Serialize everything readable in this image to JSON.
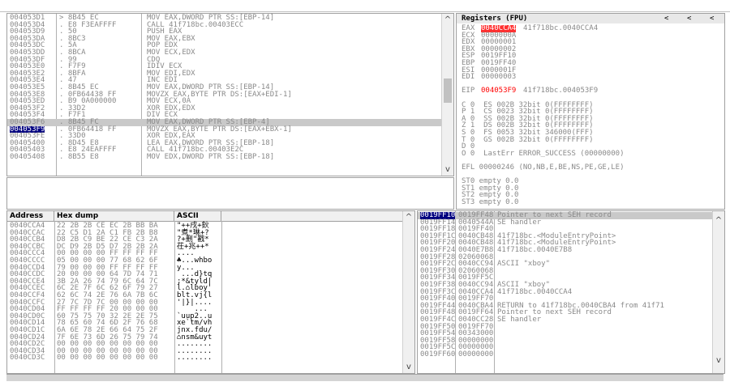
{
  "disasm": {
    "rows": [
      {
        "addr": "004053D1",
        "hex": "> 8B45 EC",
        "ins": "MOV EAX,DWORD PTR SS:[EBP-14]"
      },
      {
        "addr": "004053D4",
        "hex": ". E8 F3EAFFFF",
        "ins": "CALL 41f718bc.00403ECC"
      },
      {
        "addr": "004053D9",
        "hex": ". 50",
        "ins": "PUSH EAX"
      },
      {
        "addr": "004053DA",
        "hex": ". 8BC3",
        "ins": "MOV EAX,EBX"
      },
      {
        "addr": "004053DC",
        "hex": ". 5A",
        "ins": "POP EDX"
      },
      {
        "addr": "004053DD",
        "hex": ". 8BCA",
        "ins": "MOV ECX,EDX"
      },
      {
        "addr": "004053DF",
        "hex": ". 99",
        "ins": "CDQ"
      },
      {
        "addr": "004053E0",
        "hex": ". F7F9",
        "ins": "IDIV ECX"
      },
      {
        "addr": "004053E2",
        "hex": ". 8BFA",
        "ins": "MOV EDI,EDX"
      },
      {
        "addr": "004053E4",
        "hex": ". 47",
        "ins": "INC EDI"
      },
      {
        "addr": "004053E5",
        "hex": ". 8B45 EC",
        "ins": "MOV EAX,DWORD PTR SS:[EBP-14]"
      },
      {
        "addr": "004053E8",
        "hex": ". 0FB64438 FF",
        "ins": "MOVZX EAX,BYTE PTR DS:[EAX+EDI-1]"
      },
      {
        "addr": "004053ED",
        "hex": ". B9 0A000000",
        "ins": "MOV ECX,0A"
      },
      {
        "addr": "004053F2",
        "hex": ". 33D2",
        "ins": "XOR EDX,EDX"
      },
      {
        "addr": "004053F4",
        "hex": ". F7F1",
        "ins": "DIV ECX"
      },
      {
        "addr": "004053F6",
        "hex": ". 8B45 FC",
        "ins": "MOV EAX,DWORD PTR SS:[EBP-4]"
      },
      {
        "addr": "004053F9",
        "hex": ". 0FB64418 FF",
        "ins": "MOVZX EAX,BYTE PTR DS:[EAX+EBX-1]"
      },
      {
        "addr": "004053FE",
        "hex": ". 33D0",
        "ins": "XOR EDX,EAX"
      },
      {
        "addr": "00405400",
        "hex": ". 8D45 E8",
        "ins": "LEA EAX,DWORD PTR SS:[EBP-18]"
      },
      {
        "addr": "00405403",
        "hex": ". E8 24EAFFFF",
        "ins": "CALL 41f718bc.00403E2C"
      },
      {
        "addr": "00405408",
        "hex": ". 8B55 E8",
        "ins": "MOV EDX,DWORD PTR SS:[EBP-18]"
      }
    ],
    "highlight_addr": "004053F6",
    "selected_addr": "004053F9"
  },
  "registers": {
    "title": "Registers (FPU)",
    "nav": [
      "<",
      "<",
      "<"
    ],
    "eax": {
      "name": "EAX",
      "val": "0040CCA4",
      "note": "41f718bc.0040CCA4"
    },
    "gpr": [
      {
        "name": "ECX",
        "val": "0000000A"
      },
      {
        "name": "EDX",
        "val": "00000001"
      },
      {
        "name": "EBX",
        "val": "00000002"
      },
      {
        "name": "ESP",
        "val": "0019FF10"
      },
      {
        "name": "EBP",
        "val": "0019FF40"
      },
      {
        "name": "ESI",
        "val": "0000001F"
      },
      {
        "name": "EDI",
        "val": "00000003"
      }
    ],
    "eip": {
      "name": "EIP",
      "val": "004053F9",
      "note": "41f718bc.004053F9"
    },
    "flags": [
      "C 0  ES 002B 32bit 0(FFFFFFFF)",
      "P 1  CS 0023 32bit 0(FFFFFFFF)",
      "A 0  SS 002B 32bit 0(FFFFFFFF)",
      "Z 1  DS 002B 32bit 0(FFFFFFFF)",
      "S 0  FS 0053 32bit 346000(FFF)",
      "T 0  GS 002B 32bit 0(FFFFFFFF)",
      "D 0",
      "O 0  LastErr ERROR_SUCCESS (00000000)"
    ],
    "efl": "EFL 00000246 (NO,NB,E,BE,NS,PE,GE,LE)",
    "fpu": [
      "ST0 empty 0.0",
      "ST1 empty 0.0",
      "ST2 empty 0.0",
      "ST3 empty 0.0"
    ]
  },
  "dump": {
    "headers": {
      "address": "Address",
      "hex": "Hex dump",
      "ascii": "ASCII"
    },
    "rows": [
      {
        "addr": "0040CCA4",
        "hex": "22 2B 2B CE EC 2B BB BA",
        "ascii": "\"++戌+鈥"
      },
      {
        "addr": "0040CCAC",
        "hex": "22 C5 D1 2A C1 FB 2B B8",
        "ascii": "\"煮*琳+?"
      },
      {
        "addr": "0040CCB4",
        "hex": "D8 2B C9 BE 22 CE C3 2A",
        "ascii": "?+删\"戳*"
      },
      {
        "addr": "0040CCBC",
        "hex": "DC D9 2B D5 D7 2B 2B 2A",
        "ascii": "茌+兆++*"
      },
      {
        "addr": "0040CCC4",
        "hex": "00 00 00 00 FF FF FF FF",
        "ascii": "...."
      },
      {
        "addr": "0040CCCC",
        "hex": "05 00 00 00 77 68 62 6F",
        "ascii": "♣...whbo"
      },
      {
        "addr": "0040CCD4",
        "hex": "79 00 00 00 FF FF FF FF",
        "ascii": "y..."
      },
      {
        "addr": "0040CCDC",
        "hex": "20 00 00 00 64 7D 74 71",
        "ascii": " ...d}tq"
      },
      {
        "addr": "0040CCE4",
        "hex": "3B 2A 26 74 79 6C 64 7C",
        "ascii": ";*&tyld|"
      },
      {
        "addr": "0040CCEC",
        "hex": "6C 2E 7F 6C 62 6F 79 27",
        "ascii": "l.⌂lboy'"
      },
      {
        "addr": "0040CCF4",
        "hex": "62 6C 74 2E 76 6A 7B 6C",
        "ascii": "blt.vj{l"
      },
      {
        "addr": "0040CCFC",
        "hex": "27 7C 7D 7C 00 00 00 00",
        "ascii": "'|}|...."
      },
      {
        "addr": "0040CD04",
        "hex": "FF FF FF FF 20 00 00 00",
        "ascii": "    ..."
      },
      {
        "addr": "0040CD0C",
        "hex": "60 75 75 70 32 2E 2E 75",
        "ascii": "`uup2..u"
      },
      {
        "addr": "0040CD14",
        "hex": "78 65 60 74 6D 2F 76 68",
        "ascii": "xe`tm/vh"
      },
      {
        "addr": "0040CD1C",
        "hex": "6A 6E 78 2E 66 64 75 2F",
        "ascii": "jnx.fdu/"
      },
      {
        "addr": "0040CD24",
        "hex": "7F 6E 73 6D 26 75 79 74",
        "ascii": "⌂nsm&uyt"
      },
      {
        "addr": "0040CD2C",
        "hex": "00 00 00 00 00 00 00 00",
        "ascii": "........"
      },
      {
        "addr": "0040CD34",
        "hex": "00 00 00 00 00 00 00 00",
        "ascii": "........"
      },
      {
        "addr": "0040CD3C",
        "hex": "00 00 00 00 00 00 00 00",
        "ascii": "........"
      }
    ]
  },
  "stack": {
    "rows": [
      {
        "addr": "0019FF10",
        "val": "0019FF48",
        "note": "Pointer to next SEH record",
        "top": true
      },
      {
        "addr": "0019FF14",
        "val": "0040544A",
        "note": "SE handler"
      },
      {
        "addr": "0019FF18",
        "val": "0019FF40",
        "note": ""
      },
      {
        "addr": "0019FF1C",
        "val": "0040CB48",
        "note": "41f718bc.<ModuleEntryPoint>"
      },
      {
        "addr": "0019FF20",
        "val": "0040CB48",
        "note": "41f718bc.<ModuleEntryPoint>"
      },
      {
        "addr": "0019FF24",
        "val": "0040E7B8",
        "note": "41f718bc.0040E7B8"
      },
      {
        "addr": "0019FF28",
        "val": "02060068",
        "note": ""
      },
      {
        "addr": "0019FF2C",
        "val": "0040CC94",
        "note": "ASCII \"xboy\""
      },
      {
        "addr": "0019FF30",
        "val": "02060068",
        "note": ""
      },
      {
        "addr": "0019FF34",
        "val": "0019FF5C",
        "note": ""
      },
      {
        "addr": "0019FF38",
        "val": "0040CC94",
        "note": "ASCII \"xboy\""
      },
      {
        "addr": "0019FF3C",
        "val": "0040CCA4",
        "note": "41f718bc.0040CCA4"
      },
      {
        "addr": "0019FF40",
        "val": "0019FF70",
        "note": ""
      },
      {
        "addr": "0019FF44",
        "val": "0040CBA4",
        "note": "RETURN to 41f718bc.0040CBA4 from 41f71"
      },
      {
        "addr": "0019FF48",
        "val": "0019FF64",
        "note": "Pointer to next SEH record"
      },
      {
        "addr": "0019FF4C",
        "val": "0040CC28",
        "note": "SE handler"
      },
      {
        "addr": "0019FF50",
        "val": "0019FF70",
        "note": ""
      },
      {
        "addr": "0019FF54",
        "val": "00343000",
        "note": ""
      },
      {
        "addr": "0019FF58",
        "val": "00000000",
        "note": ""
      },
      {
        "addr": "0019FF5C",
        "val": "00000000",
        "note": ""
      },
      {
        "addr": "0019FF60",
        "val": "00000000",
        "note": ""
      }
    ]
  },
  "colors": {
    "highlight_bg": "#ff3030",
    "selection_bg": "#000080",
    "line_gray": "#c9c9c9"
  }
}
